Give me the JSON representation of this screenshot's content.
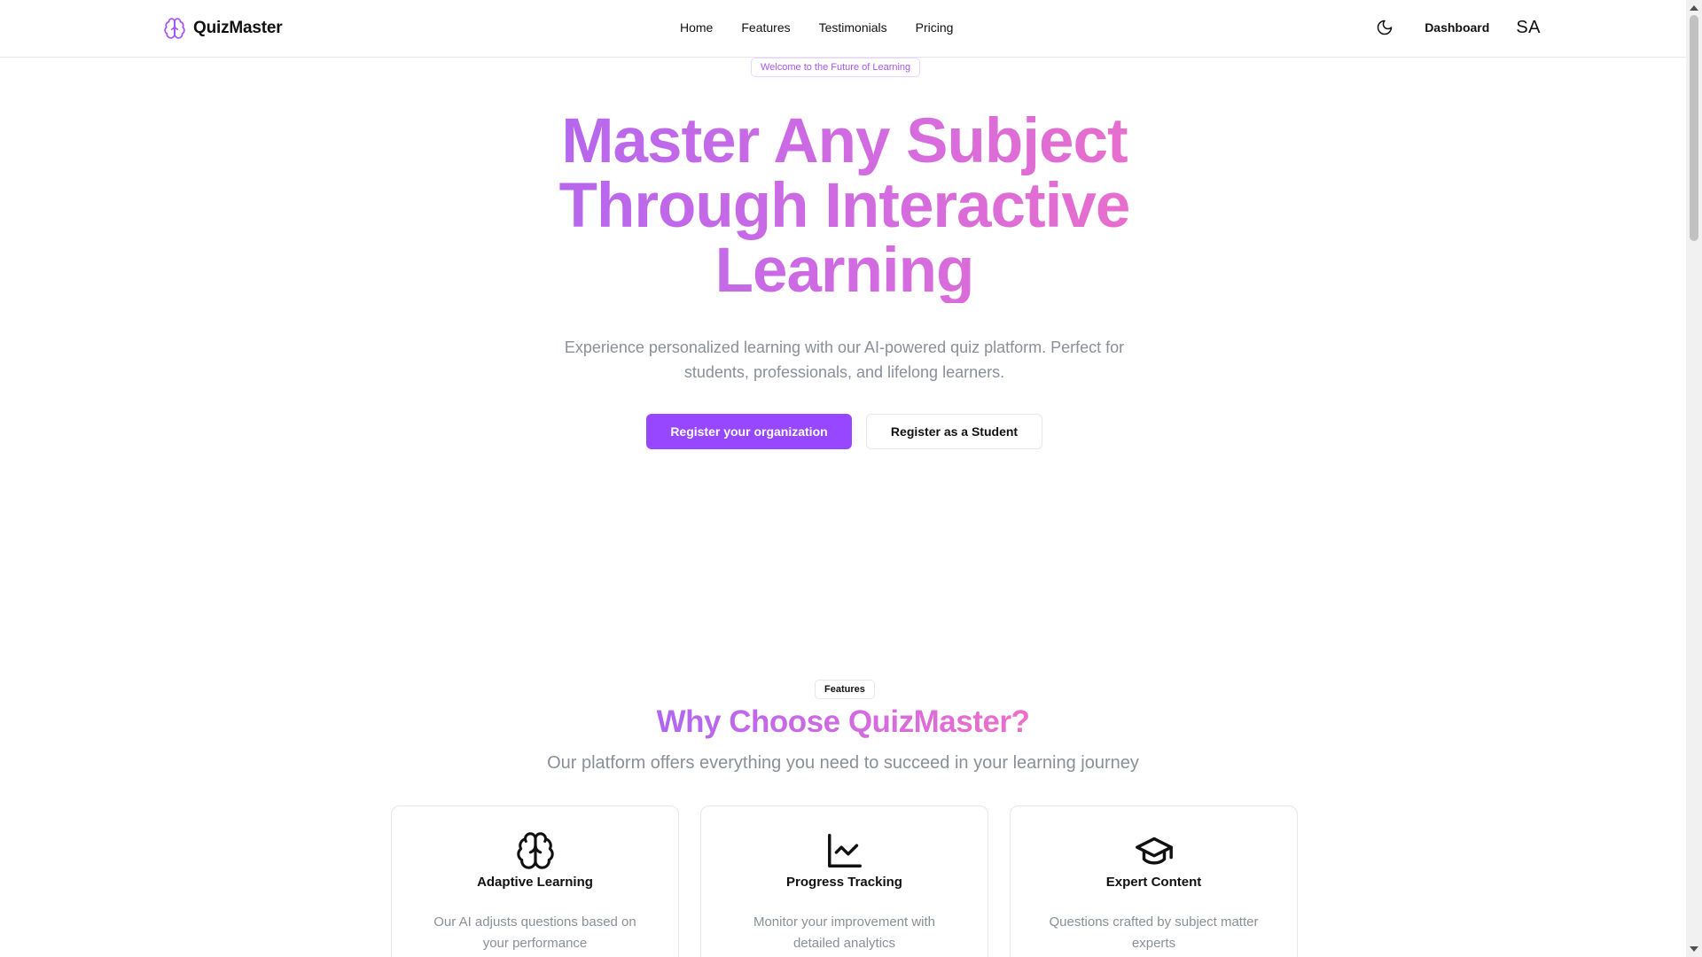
{
  "header": {
    "brand": "QuizMaster",
    "nav": [
      {
        "label": "Home"
      },
      {
        "label": "Features"
      },
      {
        "label": "Testimonials"
      },
      {
        "label": "Pricing"
      }
    ],
    "theme_icon": "moon-icon",
    "dashboard_label": "Dashboard",
    "avatar_initials": "SA"
  },
  "hero": {
    "badge": "Welcome to the Future of Learning",
    "title_lines": [
      "Master Any Subject",
      "Through Interactive",
      "Learning"
    ],
    "subtitle": "Experience personalized learning with our AI-powered quiz platform. Perfect for students, professionals, and lifelong learners.",
    "primary_cta": "Register your organization",
    "secondary_cta": "Register as a Student"
  },
  "features": {
    "badge": "Features",
    "title": "Why Choose QuizMaster?",
    "subtitle": "Our platform offers everything you need to succeed in your learning journey",
    "cards": [
      {
        "icon": "brain-icon",
        "title": "Adaptive Learning",
        "description": "Our AI adjusts questions based on your performance"
      },
      {
        "icon": "line-chart-icon",
        "title": "Progress Tracking",
        "description": "Monitor your improvement with detailed analytics"
      },
      {
        "icon": "graduation-cap-icon",
        "title": "Expert Content",
        "description": "Questions crafted by subject matter experts"
      }
    ]
  },
  "colors": {
    "accent": "#9747ff",
    "gradient_start": "#b066f0",
    "gradient_end": "#ec6fc8",
    "muted_text": "#8a8f98",
    "border": "#e5e7eb"
  }
}
